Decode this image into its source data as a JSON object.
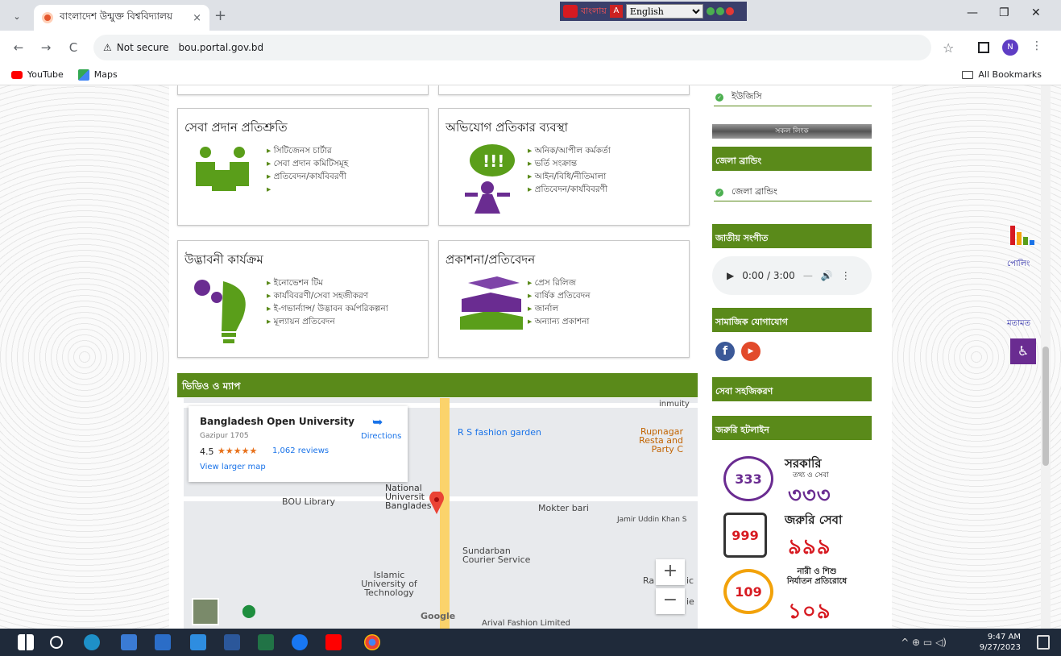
{
  "browser": {
    "tab_title": "বাংলাদেশ উন্মুক্ত বিশ্ববিদ্যালয়",
    "tab_close": "×",
    "new_tab": "+",
    "security_label": "Not secure",
    "url": "bou.portal.gov.bd",
    "avatar_letter": "N",
    "bookmarks": [
      "YouTube",
      "Maps"
    ],
    "all_bookmarks": "All Bookmarks",
    "window_controls": [
      "—",
      "❐",
      "✕"
    ]
  },
  "lang_widget": {
    "label": "বাংলায়",
    "selected_language": "English"
  },
  "cards": [
    {
      "title": "সেবা প্রদান প্রতিশ্রুতি",
      "items": [
        "সিটিজেনস চার্টার",
        "সেবা প্রদান কমিটিসমূহ",
        "প্রতিবেদন/কার্যবিবরণী",
        ""
      ]
    },
    {
      "title": "অভিযোগ প্রতিকার ব্যবস্থা",
      "items": [
        "অনিক/আপীল কর্মকর্তা",
        "ভর্তি সংক্রান্ত",
        "আইন/বিধি/নীতিমালা",
        "প্রতিবেদন/কার্যবিবরণী"
      ]
    },
    {
      "title": "উদ্ভাবনী কার্যক্রম",
      "items": [
        "ইনোভেশন টিম",
        "কার্যবিবরণী/সেবা সহজীকরণ",
        "ই-গভার্ন্যান্স/ উদ্ভাবন কর্মপরিকল্পনা",
        "মূল্যায়ন প্রতিবেদন"
      ]
    },
    {
      "title": "প্রকাশনা/প্রতিবেদন",
      "items": [
        "প্রেস রিলিজ",
        "বার্ষিক প্রতিবেদন",
        "জার্নাল",
        "অন্যান্য প্রকাশনা"
      ]
    }
  ],
  "video_map_heading": "ভিডিও ও ম্যাপ",
  "map": {
    "place_name": "Bangladesh Open University",
    "address": "Gazipur 1705",
    "rating": "4.5",
    "stars": "★★★★★",
    "reviews": "1,062 reviews",
    "directions": "Directions",
    "view_larger": "View larger map",
    "labels": {
      "rs_fashion": "R S fashion garden",
      "rupnagar": "Rupnagar Resta and Party C",
      "bou_library": "BOU Library",
      "national_univ": "National Universit Banglades",
      "mokter_bari": "Mokter bari",
      "jamir": "Jamir Uddin Khan S",
      "sundarban": "Sundarban Courier Service",
      "islamic": "Islamic University of Technology",
      "google": "Google",
      "ra": "Ra",
      "ic": "ic",
      "ie": "ie",
      "arival": "Arival Fashion Limited",
      "inmuity": "inmuity"
    },
    "zoom_in": "+",
    "zoom_out": "−"
  },
  "sidebar": {
    "top_item": "ইউজিসি",
    "all_links": "সকল লিংক",
    "district_branding_heading": "জেলা ব্রান্ডিং",
    "district_branding_item": "জেলা ব্রান্ডিং",
    "anthem_heading": "জাতীয় সংগীত",
    "audio_time": "0:00 / 3:00",
    "social_heading": "সামাজিক যোগাযোগ",
    "service_heading": "সেবা সহজিকরণ",
    "hotline_heading": "জরুরি হটলাইন",
    "hotlines": [
      {
        "badge": "333",
        "text1": "সরকারি",
        "text2": "৩৩৩",
        "sub": "তথ্য ও সেবা"
      },
      {
        "badge": "999",
        "text1": "জরুরি সেবা",
        "text2": "৯৯৯"
      },
      {
        "badge": "109",
        "text1": "নারী ও শিশু নির্যাতন প্রতিরোধে",
        "text2": "১০৯"
      }
    ]
  },
  "right_widgets": {
    "poll": "পোলিং",
    "feedback": "মতামত"
  },
  "taskbar": {
    "time": "9:47 AM",
    "date": "9/27/2023"
  }
}
